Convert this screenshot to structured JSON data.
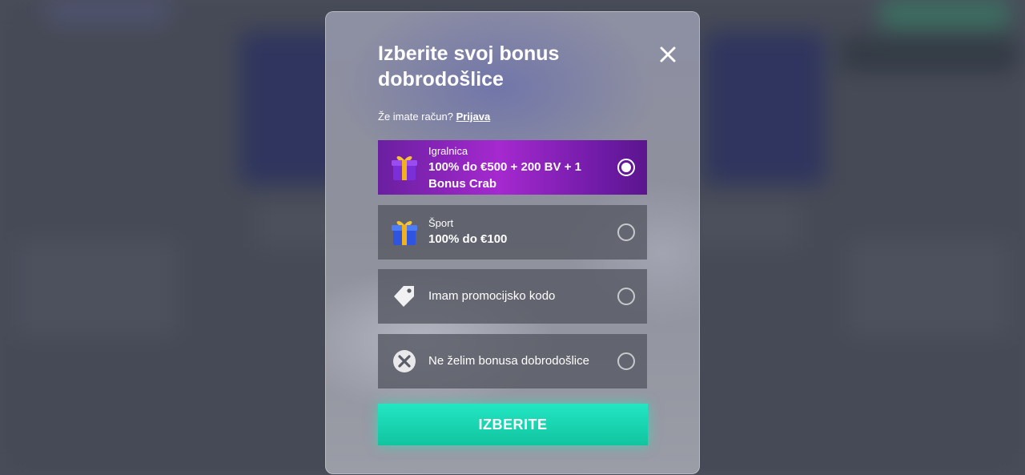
{
  "modal": {
    "title": "Izberite svoj bonus dobrodošlice",
    "login_prompt": "Že imate račun?",
    "login_link": "Prijava",
    "submit_label": "IZBERITE"
  },
  "options": [
    {
      "sub_label": "Igralnica",
      "main_label": "100% do €500 + 200 BV + 1 Bonus Crab",
      "icon": "gift-purple-icon",
      "selected": true
    },
    {
      "sub_label": "Šport",
      "main_label": "100% do €100",
      "icon": "gift-blue-icon",
      "selected": false
    },
    {
      "label": "Imam promocijsko kodo",
      "icon": "tag-icon",
      "selected": false
    },
    {
      "label": "Ne želim bonusa dobrodošlice",
      "icon": "no-bonus-x-icon",
      "selected": false
    }
  ],
  "colors": {
    "accent_button": "#1ad9b3",
    "selected_option": "#a529cf",
    "option_bg": "#555762"
  }
}
